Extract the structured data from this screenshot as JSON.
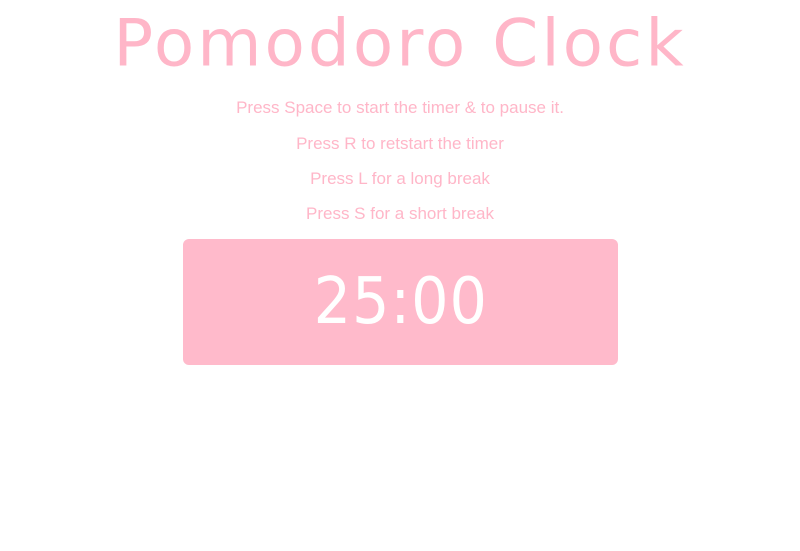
{
  "app": {
    "title": "Pomodoro Clock"
  },
  "instructions": [
    "Press Space to start the timer & to pause it.",
    "Press R to retstart the timer",
    "Press L for a long break",
    "Press S for a short break"
  ],
  "timer": {
    "display": "25:00"
  },
  "colors": {
    "accent": "#ffbacb",
    "title": "#ffb6c8",
    "instruction_text": "#ffb6c8",
    "timer_text": "#ffffff",
    "background": "#ffffff"
  }
}
